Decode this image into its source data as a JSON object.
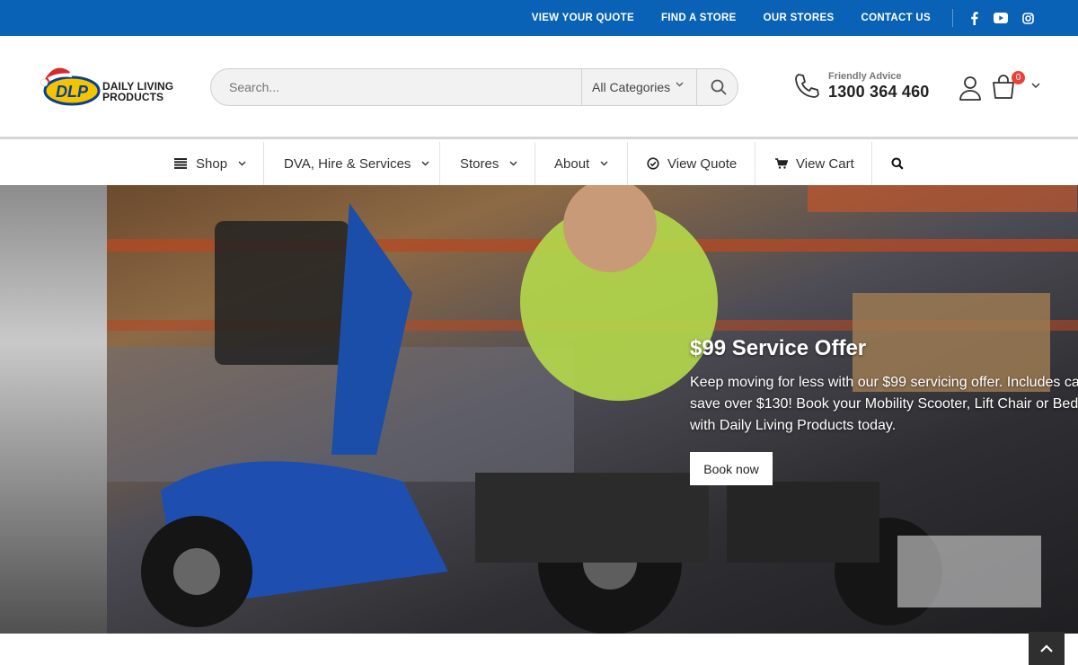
{
  "topbar": {
    "links": [
      "VIEW YOUR QUOTE",
      "FIND A STORE",
      "OUR STORES",
      "CONTACT US"
    ],
    "social_icons": [
      "facebook-icon",
      "youtube-icon",
      "instagram-icon"
    ],
    "background_color": "#0a62b6"
  },
  "header": {
    "logo": {
      "mark": "DLP",
      "line1": "DAILY LIVING",
      "line2": "PRODUCTS"
    },
    "search": {
      "placeholder": "Search...",
      "category": "All Categories"
    },
    "advice": {
      "label": "Friendly Advice",
      "phone": "1300 364 460"
    },
    "cart": {
      "count": "0"
    }
  },
  "nav": {
    "items": [
      {
        "label": "Shop",
        "icon": "menu-icon",
        "dropdown": true
      },
      {
        "label": "DVA, Hire & Services",
        "dropdown": true
      },
      {
        "label": "Stores",
        "dropdown": true
      },
      {
        "label": "About",
        "dropdown": true
      },
      {
        "label": "View Quote",
        "icon": "check-circle-icon"
      },
      {
        "label": "View Cart",
        "icon": "cart-icon"
      }
    ]
  },
  "hero": {
    "title": "$99 Service Offer",
    "description_lines": [
      "Keep moving for less with our $99 servicing offer. Includes ca",
      "save over $130! Book your Mobility Scooter, Lift Chair or Bed",
      "with Daily Living Products today."
    ],
    "button": "Book now"
  }
}
